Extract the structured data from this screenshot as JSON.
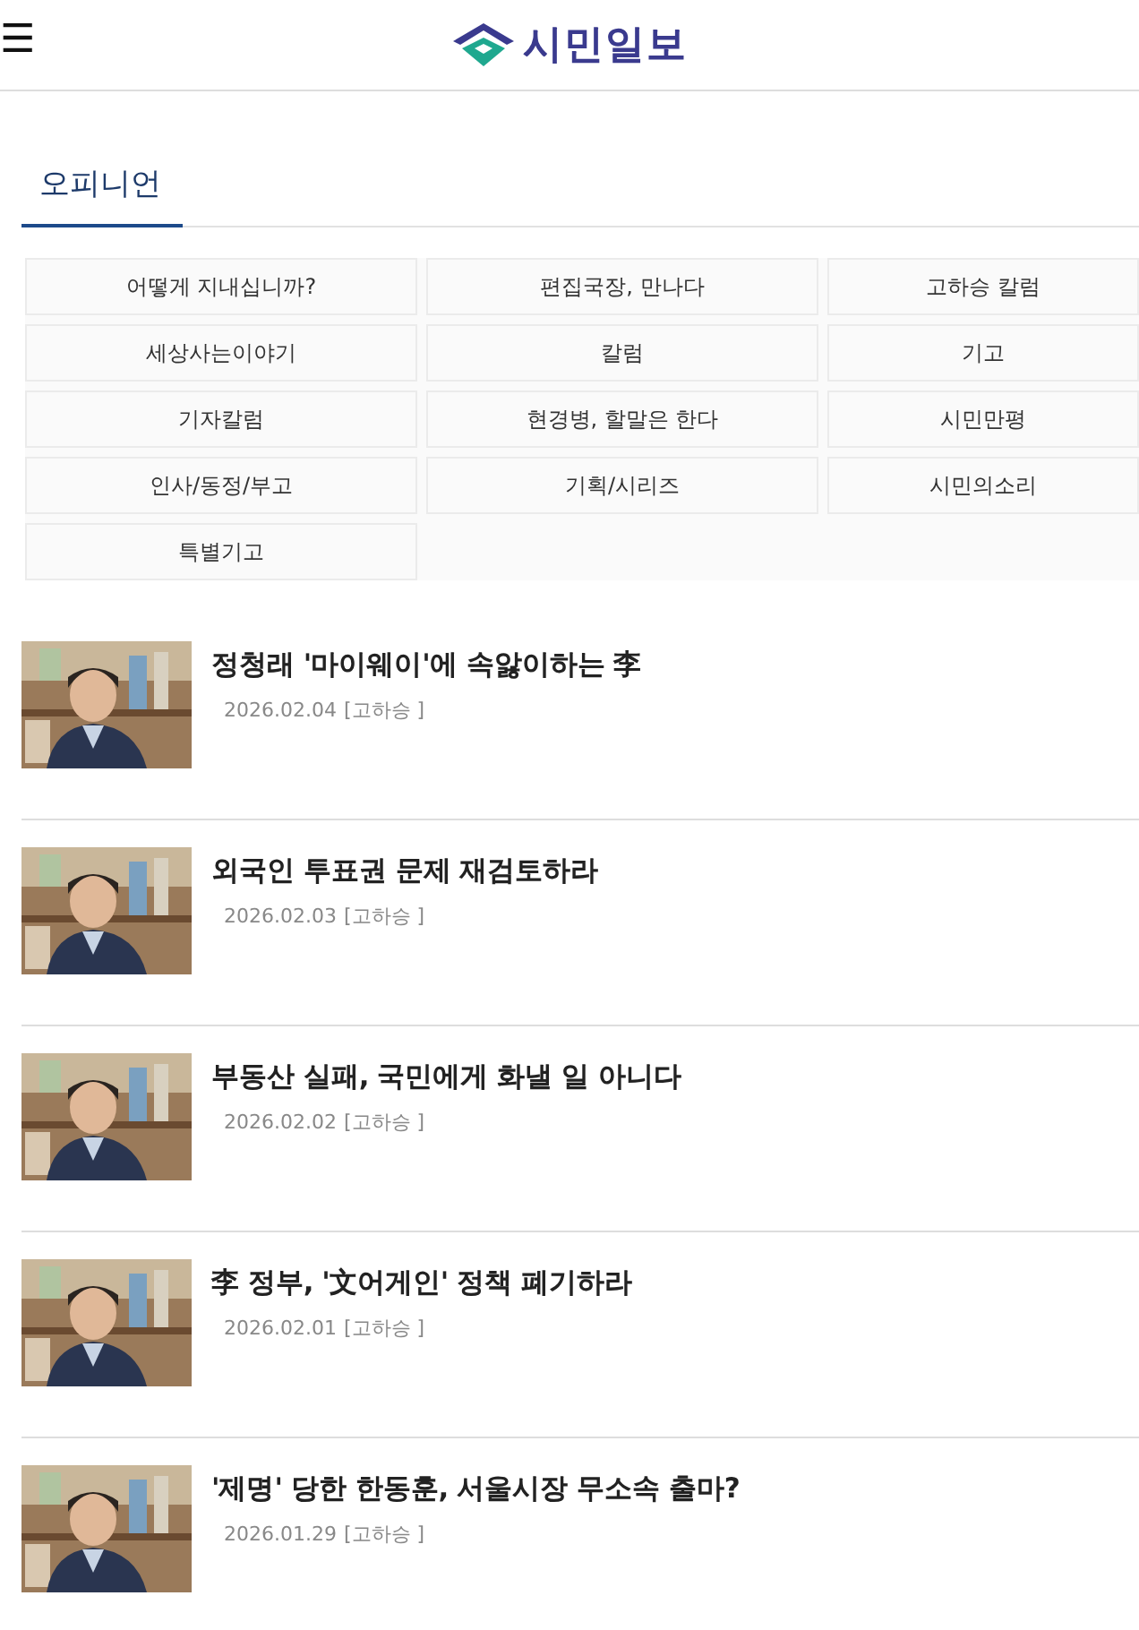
{
  "header": {
    "menu_icon": "☰",
    "logo_text": "시민일보"
  },
  "section": {
    "title": "오피니언",
    "selected": true
  },
  "categories": [
    {
      "label": "어떻게 지내십니까?"
    },
    {
      "label": "편집국장, 만나다"
    },
    {
      "label": "고하승 칼럼"
    },
    {
      "label": "세상사는이야기"
    },
    {
      "label": "칼럼"
    },
    {
      "label": "기고"
    },
    {
      "label": "기자칼럼"
    },
    {
      "label": "현경병, 할말은 한다"
    },
    {
      "label": "시민만평"
    },
    {
      "label": "인사/동정/부고"
    },
    {
      "label": "기획/시리즈"
    },
    {
      "label": "시민의소리"
    },
    {
      "label": "특별기고"
    }
  ],
  "articles": [
    {
      "title": "정청래 '마이웨이'에 속앓이하는 李",
      "date": "2026.02.04",
      "author": "[고하승 ]"
    },
    {
      "title": "외국인 투표권 문제 재검토하라",
      "date": "2026.02.03",
      "author": "[고하승 ]"
    },
    {
      "title": "부동산 실패, 국민에게 화낼 일 아니다",
      "date": "2026.02.02",
      "author": "[고하승 ]"
    },
    {
      "title": "李 정부, '文어게인' 정책 폐기하라",
      "date": "2026.02.01",
      "author": "[고하승 ]"
    },
    {
      "title": "'제명' 당한 한동훈, 서울시장 무소속 출마?",
      "date": "2026.01.29",
      "author": "[고하승 ]"
    }
  ]
}
